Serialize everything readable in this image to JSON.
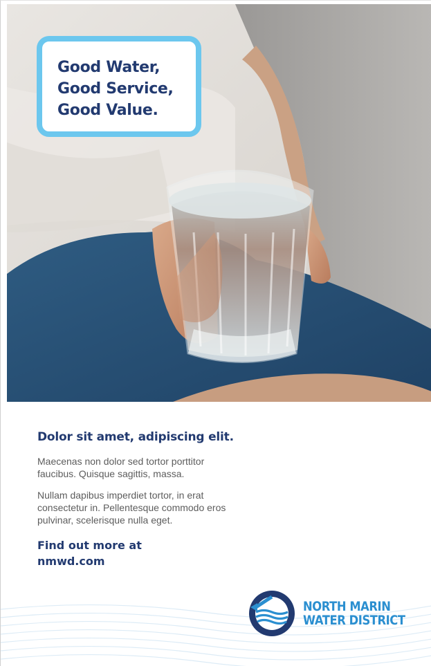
{
  "poster": {
    "headline": [
      "Good Water,",
      "Good Service,",
      "Good Value."
    ],
    "subheading": "Dolor sit amet, adipiscing elit.",
    "paragraphs": [
      "Maecenas non dolor sed tortor porttitor faucibus. Quisque sagittis, massa.",
      "Nullam dapibus imperdiet tortor, in erat consectetur in. Pellentesque commodo eros pulvinar, scelerisque nulla eget."
    ],
    "cta": [
      "Find out more at",
      "nmwd.com"
    ],
    "logo": {
      "line1": "NORTH MARIN",
      "line2": "WATER DISTRICT"
    }
  },
  "colors": {
    "navy": "#223a70",
    "headline_border": "#6cc7ee",
    "logo_blue": "#2b8fd0",
    "body_text": "#5c5c5c"
  },
  "icons": {
    "hero": "hand-holding-water-glass-photo",
    "logo": "water-waves-circle-logo-icon",
    "background": "wave-lines-decoration"
  }
}
